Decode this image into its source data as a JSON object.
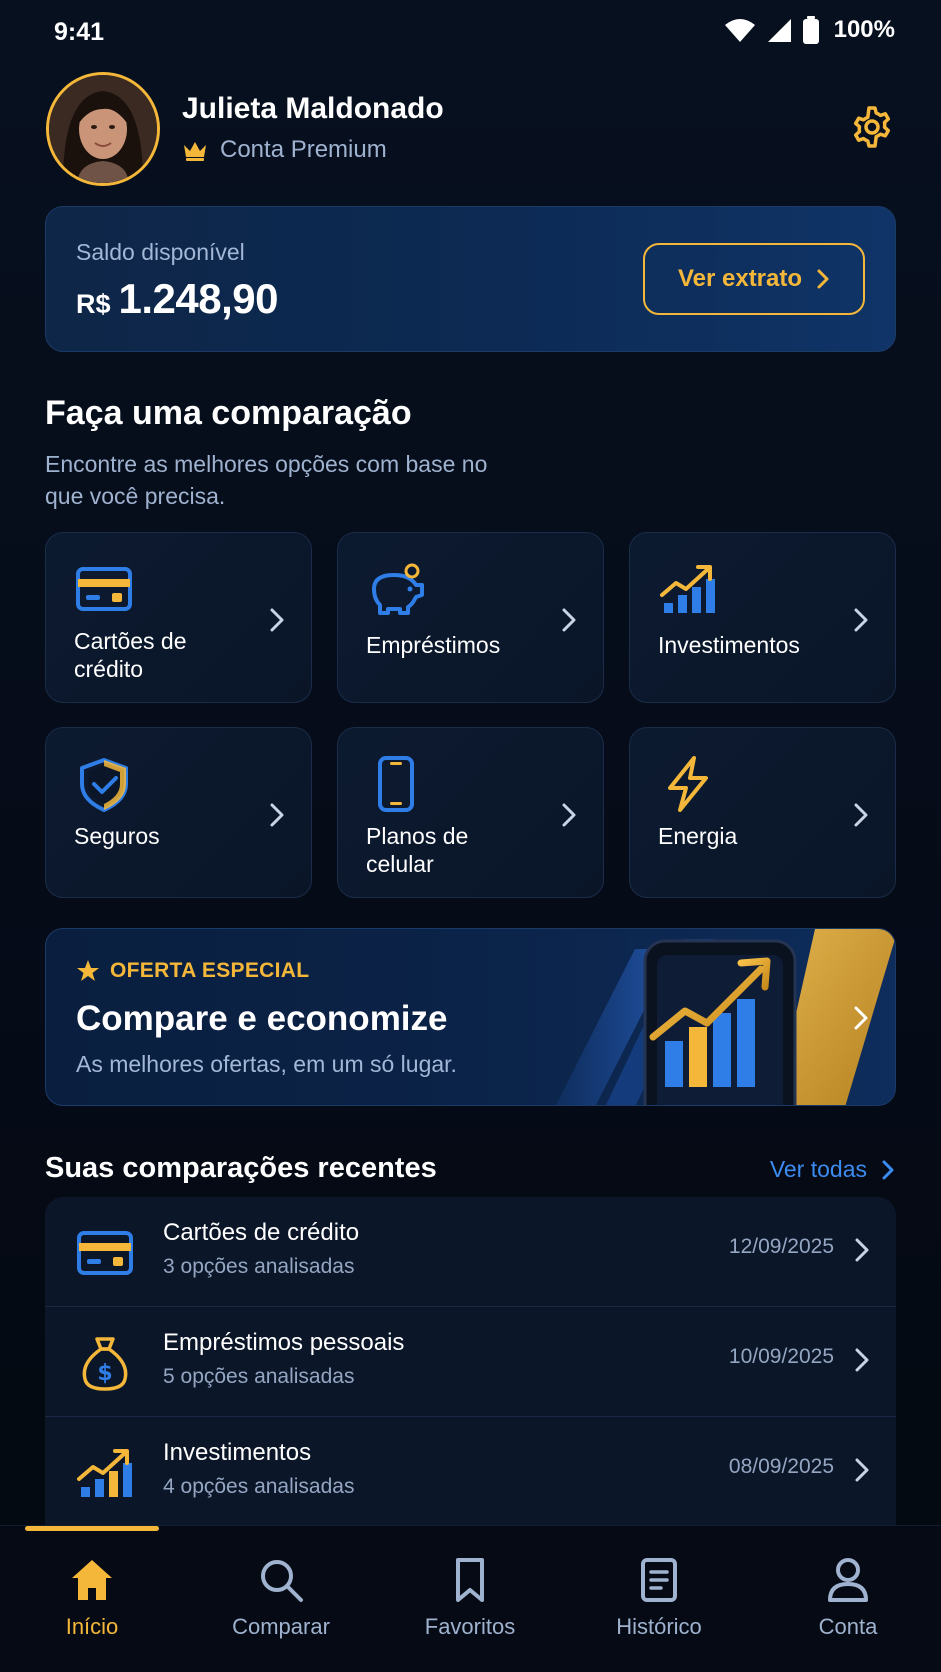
{
  "status_bar": {
    "time": "9:41",
    "battery": "100%",
    "icons": [
      "wifi-icon",
      "signal-icon",
      "battery-icon"
    ]
  },
  "header": {
    "user_name": "Julieta Maldonado",
    "account_type": "Conta Premium",
    "icons": [
      "crown-icon",
      "gear-icon"
    ]
  },
  "balance": {
    "label": "Saldo disponível",
    "currency": "R$",
    "amount": "1.248,90",
    "statement_button": "Ver extrato"
  },
  "compare": {
    "title": "Faça uma comparação",
    "subtitle": "Encontre as melhores opções com base no que você precisa.",
    "categories": [
      {
        "label": "Cartões de crédito",
        "icon": "credit-card-icon"
      },
      {
        "label": "Empréstimos",
        "icon": "piggy-bank-icon"
      },
      {
        "label": "Investimentos",
        "icon": "growth-chart-icon"
      },
      {
        "label": "Seguros",
        "icon": "shield-check-icon"
      },
      {
        "label": "Planos de celular",
        "icon": "smartphone-icon"
      },
      {
        "label": "Energia",
        "icon": "lightning-icon"
      }
    ]
  },
  "promo": {
    "tag": "OFERTA ESPECIAL",
    "title": "Compare e economize",
    "subtitle": "As melhores ofertas, em um só lugar."
  },
  "recent": {
    "title": "Suas comparações recentes",
    "see_all": "Ver todas",
    "items": [
      {
        "name": "Cartões de crédito",
        "detail": "3 opções analisadas",
        "date": "12/09/2025",
        "icon": "credit-card-icon"
      },
      {
        "name": "Empréstimos pessoais",
        "detail": "5 opções analisadas",
        "date": "10/09/2025",
        "icon": "money-bag-icon"
      },
      {
        "name": "Investimentos",
        "detail": "4 opções analisadas",
        "date": "08/09/2025",
        "icon": "growth-chart-icon"
      }
    ]
  },
  "nav": {
    "items": [
      {
        "label": "Início",
        "icon": "home-icon",
        "active": true
      },
      {
        "label": "Comparar",
        "icon": "search-icon"
      },
      {
        "label": "Favoritos",
        "icon": "bookmark-icon"
      },
      {
        "label": "Histórico",
        "icon": "document-icon"
      },
      {
        "label": "Conta",
        "icon": "user-icon"
      }
    ]
  },
  "colors": {
    "accent": "#f4b73a",
    "link": "#3b8bf0",
    "background": "#060c18",
    "icon_blue": "#2f7de6"
  }
}
